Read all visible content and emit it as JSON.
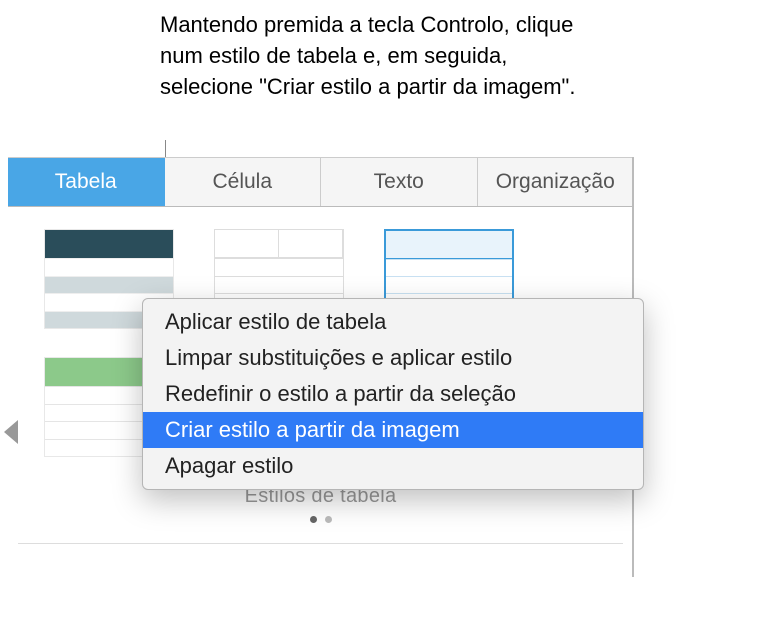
{
  "callout": "Mantendo premida a tecla Controlo, clique num estilo de tabela e, em seguida, selecione \"Criar estilo a partir da imagem\".",
  "tabs": {
    "table": "Tabela",
    "cell": "Célula",
    "text": "Texto",
    "organization": "Organização"
  },
  "styles_label": "Estilos de tabela",
  "context_menu": {
    "apply": "Aplicar estilo de tabela",
    "clear": "Limpar substituições e aplicar estilo",
    "redefine": "Redefinir o estilo a partir da seleção",
    "create": "Criar estilo a partir da imagem",
    "delete": "Apagar estilo"
  }
}
